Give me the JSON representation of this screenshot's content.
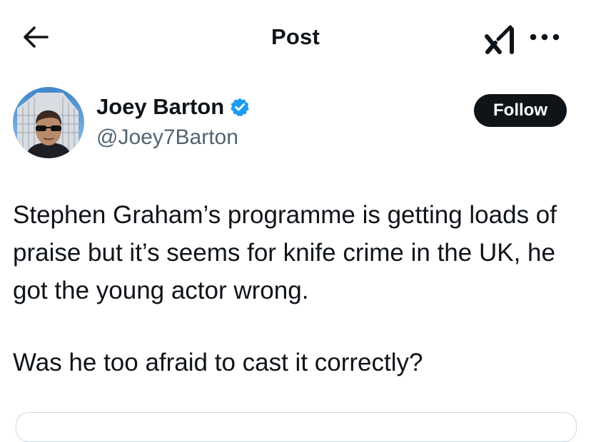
{
  "header": {
    "title": "Post",
    "back_icon": "arrow-left-icon",
    "grok_icon": "grok-logo-icon",
    "more_icon": "more-horizontal-icon"
  },
  "author": {
    "display_name": "Joey Barton",
    "handle": "@Joey7Barton",
    "verified": true,
    "verified_color": "#1d9bf0",
    "follow_label": "Follow"
  },
  "post": {
    "paragraphs": [
      "Stephen Graham’s programme is getting loads of praise but it’s seems for knife crime in the UK, he got the young actor wrong.",
      "Was he too afraid to cast it correctly?"
    ]
  }
}
